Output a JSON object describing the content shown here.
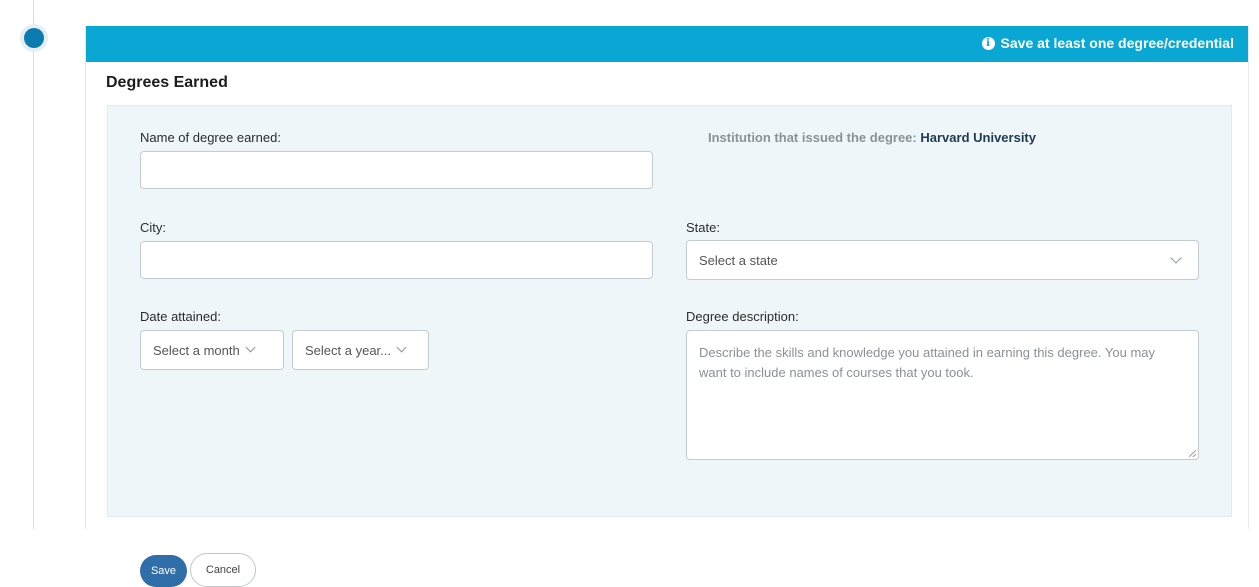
{
  "banner": {
    "message": "Save at least one degree/credential",
    "icon": "info-icon"
  },
  "section": {
    "title": "Degrees Earned"
  },
  "form": {
    "degree_name": {
      "label": "Name of degree earned:",
      "value": "",
      "placeholder": ""
    },
    "institution": {
      "label": "Institution that issued the degree:",
      "value": "Harvard University"
    },
    "city": {
      "label": "City:",
      "value": "",
      "placeholder": ""
    },
    "state": {
      "label": "State:",
      "selected": "Select a state"
    },
    "date_attained": {
      "label": "Date attained:",
      "month": "Select a month",
      "year": "Select a year..."
    },
    "description": {
      "label": "Degree description:",
      "placeholder": "Describe the skills and knowledge you attained in earning this degree. You may want to include names of courses that you took."
    }
  },
  "actions": {
    "save": "Save",
    "cancel": "Cancel"
  },
  "colors": {
    "banner": "#0aa6d4",
    "save_button": "#2f6ea8",
    "panel": "#eef6f9",
    "timeline_dot": "#0c7bb0"
  }
}
